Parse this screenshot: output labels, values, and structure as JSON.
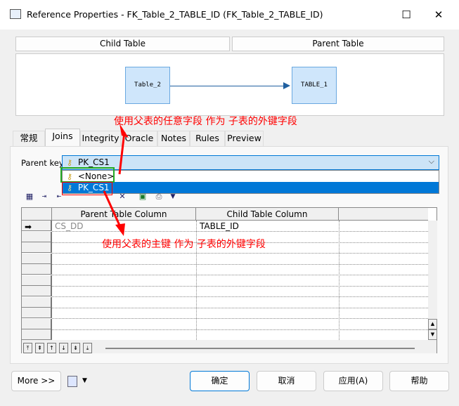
{
  "window": {
    "title": "Reference Properties - FK_Table_2_TABLE_ID (FK_Table_2_TABLE_ID)"
  },
  "header": {
    "child_table": "Child Table",
    "parent_table": "Parent Table"
  },
  "diagram": {
    "child": "Table_2",
    "parent": "TABLE_1"
  },
  "annotations": {
    "top": "使用父表的任意字段  作为  子表的外键字段",
    "bottom": "使用父表的主键   作为  子表的外键字段",
    "arrow_color": "#ff0000",
    "green_box": "#22aa22"
  },
  "tabs": [
    {
      "label": "常规"
    },
    {
      "label": "Joins"
    },
    {
      "label": "Integrity"
    },
    {
      "label": "Oracle"
    },
    {
      "label": "Notes"
    },
    {
      "label": "Rules"
    },
    {
      "label": "Preview"
    }
  ],
  "active_tab": "Joins",
  "parent_key": {
    "label": "Parent key:",
    "value": "PK_CS1",
    "options": [
      "<None>",
      "PK_CS1"
    ],
    "highlighted": "PK_CS1"
  },
  "grid": {
    "columns": [
      "Parent Table Column",
      "Child Table Column"
    ],
    "rows": [
      {
        "parent": "CS_DD",
        "child": "TABLE_ID"
      }
    ]
  },
  "buttons": {
    "more": "More >>",
    "ok": "确定",
    "cancel": "取消",
    "apply": "应用(A)",
    "help": "帮助"
  },
  "colors": {
    "selection": "#0078d7",
    "combo_bg": "#cce4f7"
  }
}
